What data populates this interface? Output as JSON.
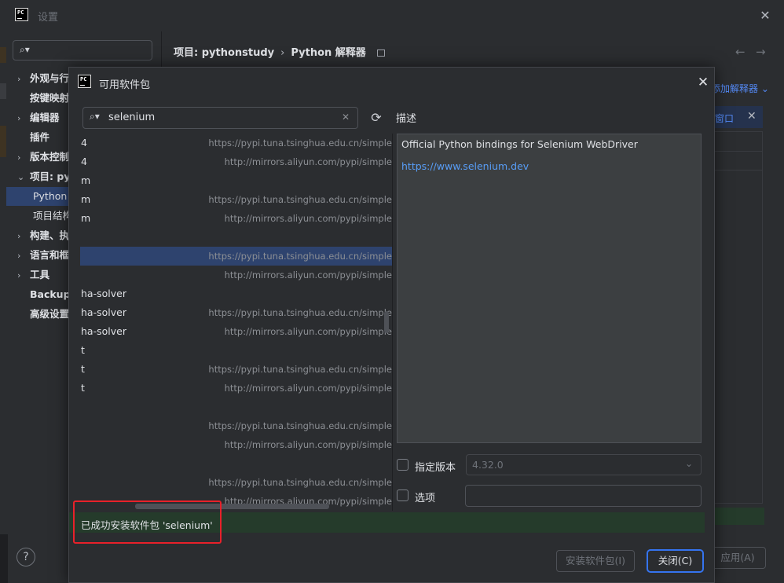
{
  "settings": {
    "title": "设置",
    "close_icon": "✕",
    "sidebar": {
      "items": [
        {
          "label": "外观与行为",
          "expandable": true
        },
        {
          "label": "按键映射",
          "expandable": false
        },
        {
          "label": "编辑器",
          "expandable": true
        },
        {
          "label": "插件",
          "expandable": false
        },
        {
          "label": "版本控制",
          "expandable": true
        },
        {
          "label": "项目: pythonstudy",
          "expandable": true,
          "expanded": true
        },
        {
          "label": "Python 解释器",
          "sub": true,
          "selected": true
        },
        {
          "label": "项目结构",
          "sub": true
        },
        {
          "label": "构建、执行、部署",
          "expandable": true
        },
        {
          "label": "语言和框架",
          "expandable": true
        },
        {
          "label": "工具",
          "expandable": true
        },
        {
          "label": "Backup and Sync",
          "expandable": false
        },
        {
          "label": "高级设置",
          "expandable": false
        }
      ]
    },
    "breadcrumb": {
      "project": "项目: pythonstudy",
      "separator": "›",
      "page": "Python 解释器"
    },
    "add_interpreter": "添加解释器 ⌄",
    "banner_text": "窗口",
    "apply_label": "应用(A)",
    "help_label": "?"
  },
  "dialog": {
    "title": "可用软件包",
    "search_value": "selenium",
    "packages": [
      {
        "name": "4",
        "repo": "https://pypi.tuna.tsinghua.edu.cn/simple"
      },
      {
        "name": "4",
        "repo": "http://mirrors.aliyun.com/pypi/simple"
      },
      {
        "name": "m",
        "repo": ""
      },
      {
        "name": "m",
        "repo": "https://pypi.tuna.tsinghua.edu.cn/simple"
      },
      {
        "name": "m",
        "repo": "http://mirrors.aliyun.com/pypi/simple"
      },
      {
        "name": "",
        "repo": ""
      },
      {
        "name": "",
        "repo": "https://pypi.tuna.tsinghua.edu.cn/simple",
        "selected": true
      },
      {
        "name": "",
        "repo": "http://mirrors.aliyun.com/pypi/simple"
      },
      {
        "name": "ha-solver",
        "repo": ""
      },
      {
        "name": "ha-solver",
        "repo": "https://pypi.tuna.tsinghua.edu.cn/simple"
      },
      {
        "name": "ha-solver",
        "repo": "http://mirrors.aliyun.com/pypi/simple"
      },
      {
        "name": "t",
        "repo": ""
      },
      {
        "name": "t",
        "repo": "https://pypi.tuna.tsinghua.edu.cn/simple"
      },
      {
        "name": "t",
        "repo": "http://mirrors.aliyun.com/pypi/simple"
      },
      {
        "name": "",
        "repo": ""
      },
      {
        "name": "",
        "repo": "https://pypi.tuna.tsinghua.edu.cn/simple"
      },
      {
        "name": "",
        "repo": "http://mirrors.aliyun.com/pypi/simple"
      },
      {
        "name": "",
        "repo": ""
      },
      {
        "name": "",
        "repo": "https://pypi.tuna.tsinghua.edu.cn/simple"
      },
      {
        "name": "",
        "repo": "http://mirrors.aliyun.com/pypi/simple"
      }
    ],
    "description_label": "描述",
    "description_text": "Official Python bindings for Selenium WebDriver",
    "description_link": "https://www.selenium.dev",
    "version_label": "指定版本",
    "version_value": "4.32.0",
    "options_label": "选项",
    "status_text": "已成功安装软件包 'selenium'",
    "install_label": "安装软件包(I)",
    "close_label": "关闭(C)"
  }
}
